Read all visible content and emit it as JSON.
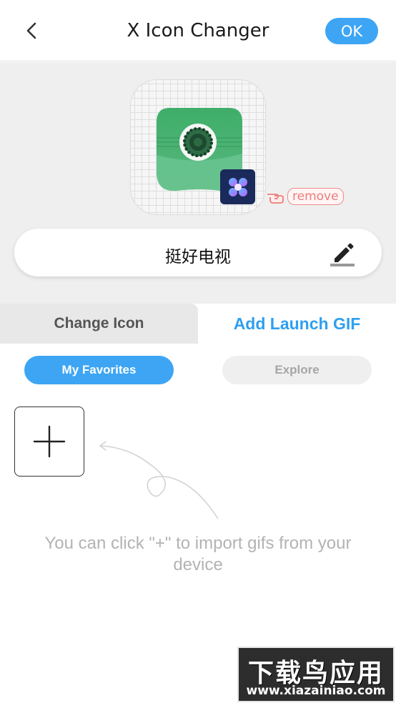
{
  "header": {
    "title": "X Icon Changer",
    "ok_label": "OK",
    "back_icon": "chevron-left-icon"
  },
  "preview": {
    "app_icon": "tv-app-icon",
    "badge_icon": "x-icon-changer-badge",
    "remove_label": "remove",
    "app_name": "挺好电视",
    "edit_icon": "pencil-icon"
  },
  "tabs": [
    {
      "label": "Change Icon",
      "active": false
    },
    {
      "label": "Add Launch GIF",
      "active": true
    }
  ],
  "segments": [
    {
      "label": "My Favorites",
      "active": true
    },
    {
      "label": "Explore",
      "active": false
    }
  ],
  "gif_panel": {
    "add_icon": "plus-icon",
    "hint": "You can click \"+\" to import gifs from your device"
  },
  "watermark": {
    "title": "下载鸟应用",
    "url": "www.xiazainiao.com"
  },
  "colors": {
    "accent": "#3da5f4",
    "tab_active_text": "#2f9ff0",
    "remove": "#ee7b7b",
    "icon_green": "#4caf72"
  }
}
